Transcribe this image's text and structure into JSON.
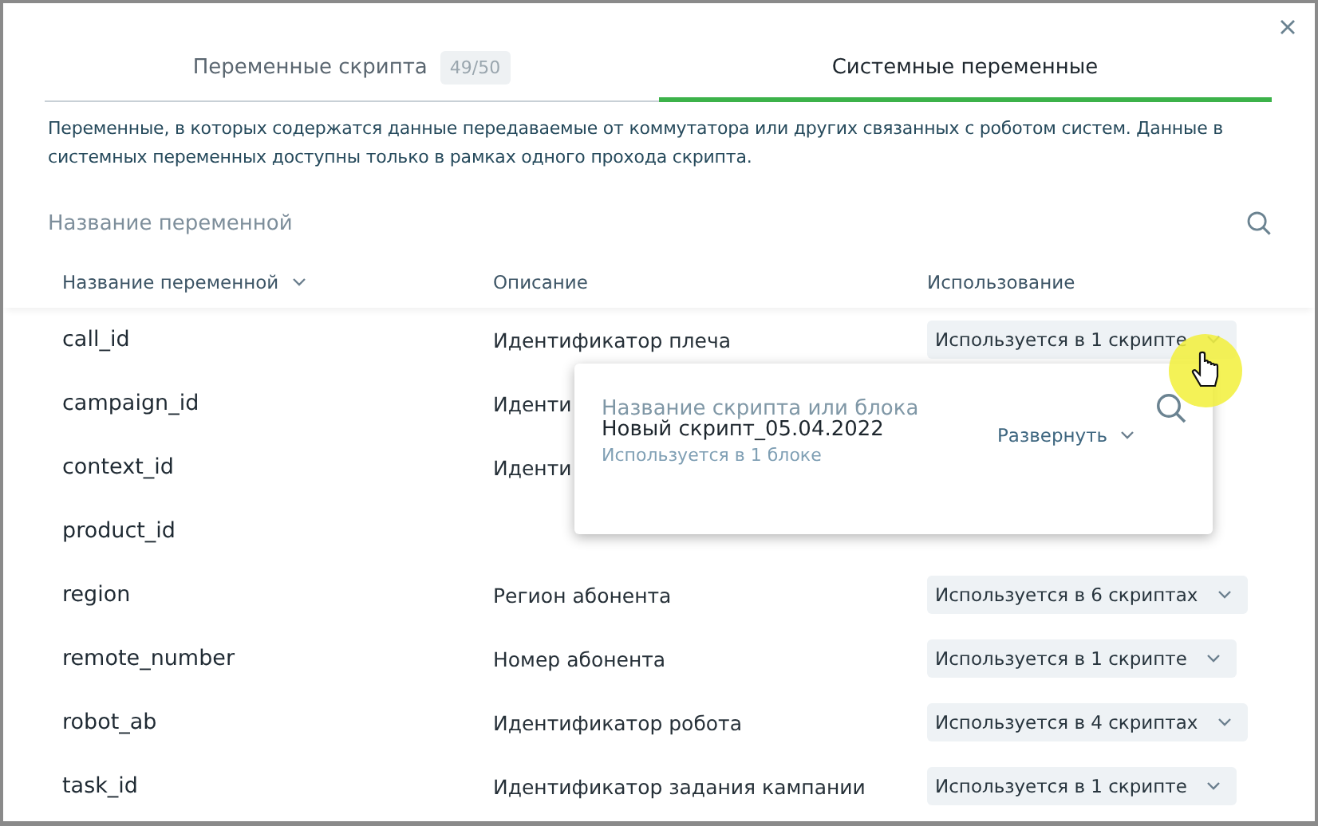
{
  "tabs": [
    {
      "label": "Переменные скрипта",
      "count": "49/50",
      "selected": false
    },
    {
      "label": "Системные переменные",
      "selected": true
    }
  ],
  "description": "Переменные, в которых содержатся данные передаваемые от коммутатора или других связанных с роботом систем. Данные в системных переменных доступны только в рамках одного прохода скрипта.",
  "search": {
    "placeholder": "Название переменной"
  },
  "table": {
    "columns": [
      "Название переменной",
      "Описание",
      "Использование"
    ],
    "rows": [
      {
        "name": "call_id",
        "description": "Идентификатор плеча",
        "usage": "Используется в 1 скрипте"
      },
      {
        "name": "campaign_id",
        "description": "Иденти"
      },
      {
        "name": "context_id",
        "description": "Иденти"
      },
      {
        "name": "product_id"
      },
      {
        "name": "region",
        "description": "Регион абонента",
        "usage": "Используется в 6 скриптах"
      },
      {
        "name": "remote_number",
        "description": "Номер абонента",
        "usage": "Используется в 1 скрипте"
      },
      {
        "name": "robot_ab",
        "description": "Идентификатор робота",
        "usage": "Используется в 4 скриптах"
      },
      {
        "name": "task_id",
        "description": "Идентификатор задания кампании",
        "usage": "Используется в 1 скрипте"
      }
    ]
  },
  "popover": {
    "placeholder": "Название скрипта или блока",
    "items": [
      {
        "title": "Новый скрипт_05.04.2022",
        "subtitle": "Используется в 1 блоке",
        "action": "Развернуть"
      }
    ]
  }
}
